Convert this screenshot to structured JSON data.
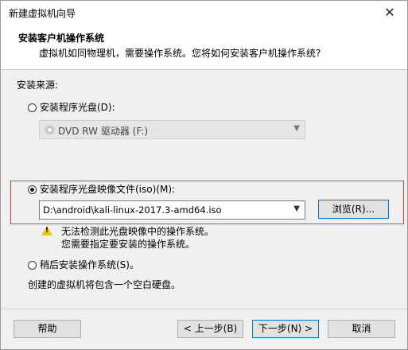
{
  "window": {
    "title": "新建虚拟机向导",
    "close_glyph": "✕"
  },
  "header": {
    "title": "安装客户机操作系统",
    "description": "虚拟机如同物理机，需要操作系统。您将如何安装客户机操作系统?"
  },
  "content": {
    "source_label": "安装来源:",
    "disc_option": {
      "label": "安装程序光盘(D):",
      "selected": false,
      "drive_value": "DVD RW 驱动器 (F:)",
      "enabled": false
    },
    "iso_option": {
      "label": "安装程序光盘映像文件(iso)(M):",
      "selected": true,
      "path_value": "D:\\android\\kali-linux-2017.3-amd64.iso",
      "browse_label": "浏览(R)..."
    },
    "warning": {
      "icon": "warning-icon",
      "line1": "无法检测此光盘映像中的操作系统。",
      "line2": "您需要指定要安装的操作系统。"
    },
    "later_option": {
      "label": "稍后安装操作系统(S)。",
      "selected": false,
      "description": "创建的虚拟机将包含一个空白硬盘。"
    }
  },
  "footer": {
    "help_label": "帮助",
    "back_label": "< 上一步(B)",
    "next_label": "下一步(N) >",
    "cancel_label": "取消"
  },
  "colors": {
    "highlight_border": "#e53935",
    "focus_border": "#0078d7",
    "warning_yellow": "#f4c400"
  }
}
